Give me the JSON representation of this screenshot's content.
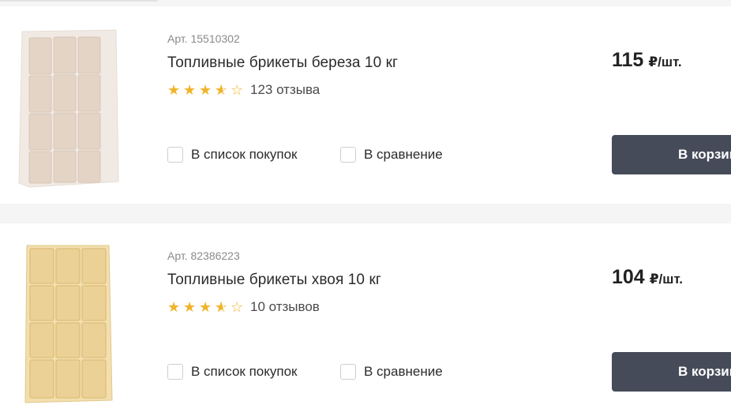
{
  "products": [
    {
      "article": "Арт. 15510302",
      "title": "Топливные брикеты береза 10 кг",
      "rating": 3.5,
      "reviews": "123 отзыва",
      "shopping_list_label": "В список покупок",
      "compare_label": "В сравнение",
      "price": "115",
      "price_unit": "₽/шт.",
      "cart_label": "В корзину",
      "image_color": "#e8dcd0"
    },
    {
      "article": "Арт. 82386223",
      "title": "Топливные брикеты хвоя 10 кг",
      "rating": 3.5,
      "reviews": "10 отзывов",
      "shopping_list_label": "В список покупок",
      "compare_label": "В сравнение",
      "price": "104",
      "price_unit": "₽/шт.",
      "cart_label": "В корзину",
      "image_color": "#ecd29a"
    }
  ],
  "icons": {
    "star_full": "★",
    "star_empty": "☆"
  }
}
